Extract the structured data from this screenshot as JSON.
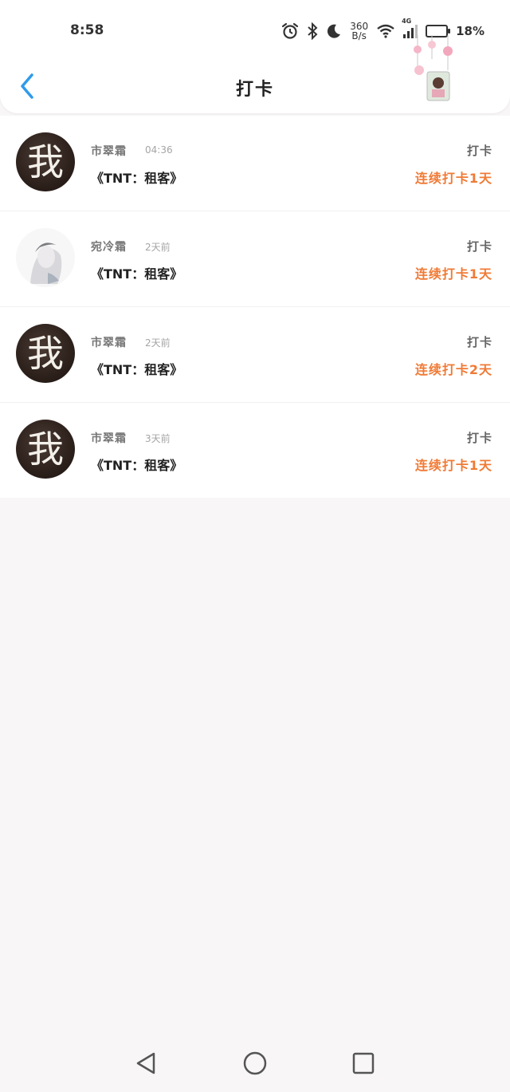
{
  "status_bar": {
    "time": "8:58",
    "net_speed_value": "360",
    "net_speed_unit": "B/s",
    "signal_type": "4G",
    "battery": "18%"
  },
  "header": {
    "title": "打卡"
  },
  "records": [
    {
      "name": "市翠霜",
      "time": "04:36",
      "book": "《TNT：租客》",
      "label": "打卡",
      "streak": "连续打卡1天",
      "avatar_glyph": "我"
    },
    {
      "name": "宛冷霜",
      "time": "2天前",
      "book": "《TNT：租客》",
      "label": "打卡",
      "streak": "连续打卡1天",
      "avatar_glyph": ""
    },
    {
      "name": "市翠霜",
      "time": "2天前",
      "book": "《TNT：租客》",
      "label": "打卡",
      "streak": "连续打卡2天",
      "avatar_glyph": "我"
    },
    {
      "name": "市翠霜",
      "time": "3天前",
      "book": "《TNT：租客》",
      "label": "打卡",
      "streak": "连续打卡1天",
      "avatar_glyph": "我"
    }
  ],
  "colors": {
    "accent_blue": "#2f9bea",
    "streak_orange": "#f07a35",
    "page_bg": "#f8f6f7"
  },
  "icons": {
    "back": "chevron-left-icon",
    "nav_back": "triangle-back-icon",
    "nav_home": "circle-home-icon",
    "nav_recents": "square-recents-icon"
  }
}
